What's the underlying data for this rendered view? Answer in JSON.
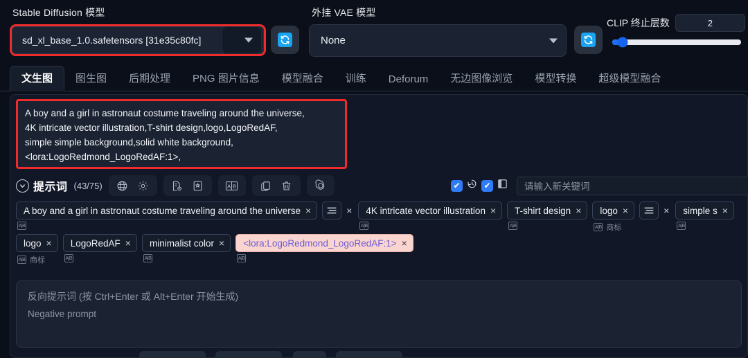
{
  "topbar": {
    "model_label": "Stable Diffusion 模型",
    "model_value": "sd_xl_base_1.0.safetensors [31e35c80fc]",
    "vae_label": "外挂 VAE 模型",
    "vae_value": "None",
    "clip_label": "CLIP 终止层数",
    "clip_value": "2",
    "clip_percent": 8,
    "refresh_icon": "refresh-icon",
    "accent_blue": "#1aa3f0",
    "annotation_red": "#ef2b2b"
  },
  "tabs": [
    {
      "label": "文生图",
      "active": true
    },
    {
      "label": "图生图",
      "active": false
    },
    {
      "label": "后期处理",
      "active": false
    },
    {
      "label": "PNG 图片信息",
      "active": false
    },
    {
      "label": "模型融合",
      "active": false
    },
    {
      "label": "训练",
      "active": false
    },
    {
      "label": "Deforum",
      "active": false
    },
    {
      "label": "无边图像浏览",
      "active": false
    },
    {
      "label": "模型转换",
      "active": false
    },
    {
      "label": "超级模型融合",
      "active": false
    }
  ],
  "prompt": {
    "lines": [
      "A boy and a girl in astronaut costume traveling around the universe,",
      "4K intricate vector illustration,T-shirt design,logo,LogoRedAF,",
      "simple simple background,solid white background,",
      "<lora:LogoRedmond_LogoRedAF:1>,"
    ]
  },
  "toolbar": {
    "title": "提示词",
    "count": "(43/75)",
    "collapse_icon": "chevron-down-icon",
    "icons": [
      {
        "name": "globe-icon",
        "group": 0
      },
      {
        "name": "gear-icon",
        "group": 0
      },
      {
        "name": "document-clock-icon",
        "group": 1
      },
      {
        "name": "bookmark-icon",
        "group": 1
      },
      {
        "name": "translate-ab-icon",
        "group": 2
      },
      {
        "name": "copy-icon",
        "group": 3
      },
      {
        "name": "trash-icon",
        "group": 3
      },
      {
        "name": "spiral-ai-icon",
        "group": 4
      }
    ],
    "checkbox_1_checked": true,
    "checkbox_2_checked": true,
    "history_icon": "undo-clock-icon",
    "panel_icon": "split-panel-icon",
    "keyword_placeholder": "请输入新关键词"
  },
  "tags": {
    "row1": [
      {
        "text": "A boy and a girl in astronaut costume traveling around the universe",
        "type": "tag",
        "sub": "",
        "has_translate": true
      },
      {
        "text": "",
        "type": "group",
        "sub": "",
        "has_translate": false
      },
      {
        "text": "4K intricate vector illustration",
        "type": "tag",
        "sub": "",
        "has_translate": true
      },
      {
        "text": "T-shirt design",
        "type": "tag",
        "sub": "",
        "has_translate": true
      },
      {
        "text": "logo",
        "type": "tag",
        "sub": "商标",
        "has_translate": true
      },
      {
        "text": "",
        "type": "group",
        "sub": "",
        "has_translate": false
      },
      {
        "text": "simple s",
        "type": "tag",
        "sub": "",
        "has_translate": true
      }
    ],
    "row2": [
      {
        "text": "logo",
        "type": "tag",
        "sub": "商标",
        "has_translate": true
      },
      {
        "text": "LogoRedAF",
        "type": "tag",
        "sub": "",
        "has_translate": true
      },
      {
        "text": "minimalist color",
        "type": "tag",
        "sub": "",
        "has_translate": true
      },
      {
        "text": "<lora:LogoRedmond_LogoRedAF:1>",
        "type": "lora",
        "sub": "",
        "has_translate": true
      }
    ],
    "remove_symbol": "×",
    "group_icon": "tag-group-icon"
  },
  "negative": {
    "placeholder_cn": "反向提示词 (按 Ctrl+Enter 或 Alt+Enter 开始生成)",
    "placeholder_en": "Negative prompt"
  }
}
